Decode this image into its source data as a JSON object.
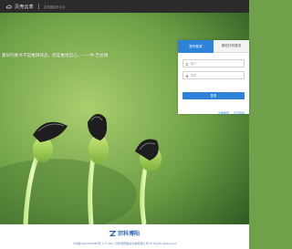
{
  "header": {
    "brand": "贝壳云表",
    "subtitle": "浏览器操作平台"
  },
  "hero": {
    "slogan": "最好的要点不是推销商品，而是推销自己。——乔·吉拉德"
  },
  "login": {
    "tabs": [
      {
        "label": "账号登录",
        "active": true
      },
      {
        "label": "微信扫码登录",
        "active": false
      }
    ],
    "username_placeholder": "账户",
    "password_placeholder": "密码",
    "submit_label": "登录",
    "links": [
      "注册账号",
      "忘记密码"
    ]
  },
  "footer": {
    "logo_text": "宗科博阳",
    "copyright": "ICP备2021003280号-1  © 2017 宗科博阳信息科技有限公司 All Rights Reserved"
  },
  "colors": {
    "accent": "#2e83d8",
    "topbar": "#2b2b2b",
    "hero_green": "#6fa04a"
  }
}
